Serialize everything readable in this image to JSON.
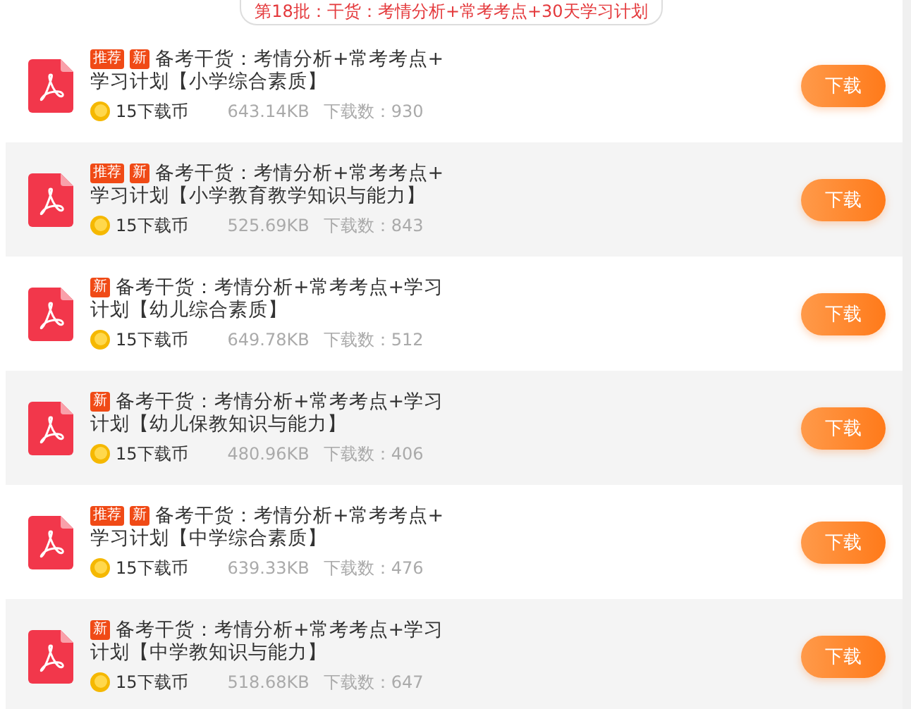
{
  "banner": "第18批：干货：考情分析+常考考点+30天学习计划",
  "items": [
    {
      "recommended": true,
      "new": true,
      "badge_recommended": "推荐",
      "badge_new": "新",
      "title_line_1": "备考干货：考情分析+常考考点+",
      "title_line_2": "学习计划【小学综合素质】",
      "coins": "15下载币",
      "size": "643.14KB",
      "downloads": "下载数：930",
      "button": "下载"
    },
    {
      "recommended": true,
      "new": true,
      "badge_recommended": "推荐",
      "badge_new": "新",
      "title_line_1": "备考干货：考情分析+常考考点+",
      "title_line_2": "学习计划【小学教育教学知识与能力】",
      "coins": "15下载币",
      "size": "525.69KB",
      "downloads": "下载数：843",
      "button": "下载"
    },
    {
      "recommended": false,
      "new": true,
      "badge_new": "新",
      "title_line_1": "备考干货：考情分析+常考考点+学习",
      "title_line_2": "计划【幼儿综合素质】",
      "coins": "15下载币",
      "size": "649.78KB",
      "downloads": "下载数：512",
      "button": "下载"
    },
    {
      "recommended": false,
      "new": true,
      "badge_new": "新",
      "title_line_1": "备考干货：考情分析+常考考点+学习",
      "title_line_2": "计划【幼儿保教知识与能力】",
      "coins": "15下载币",
      "size": "480.96KB",
      "downloads": "下载数：406",
      "button": "下载"
    },
    {
      "recommended": true,
      "new": true,
      "badge_recommended": "推荐",
      "badge_new": "新",
      "title_line_1": "备考干货：考情分析+常考考点+",
      "title_line_2": "学习计划【中学综合素质】",
      "coins": "15下载币",
      "size": "639.33KB",
      "downloads": "下载数：476",
      "button": "下载"
    },
    {
      "recommended": false,
      "new": true,
      "badge_new": "新",
      "title_line_1": "备考干货：考情分析+常考考点+学习",
      "title_line_2": "计划【中学教知识与能力】",
      "coins": "15下载币",
      "size": "518.68KB",
      "downloads": "下载数：647",
      "button": "下载"
    }
  ]
}
